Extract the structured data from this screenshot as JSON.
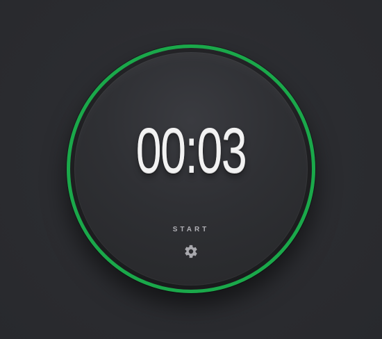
{
  "timer": {
    "display": "00:03",
    "start_label": "START",
    "settings_icon": "gear-icon",
    "accent_color": "#1aa84a"
  }
}
